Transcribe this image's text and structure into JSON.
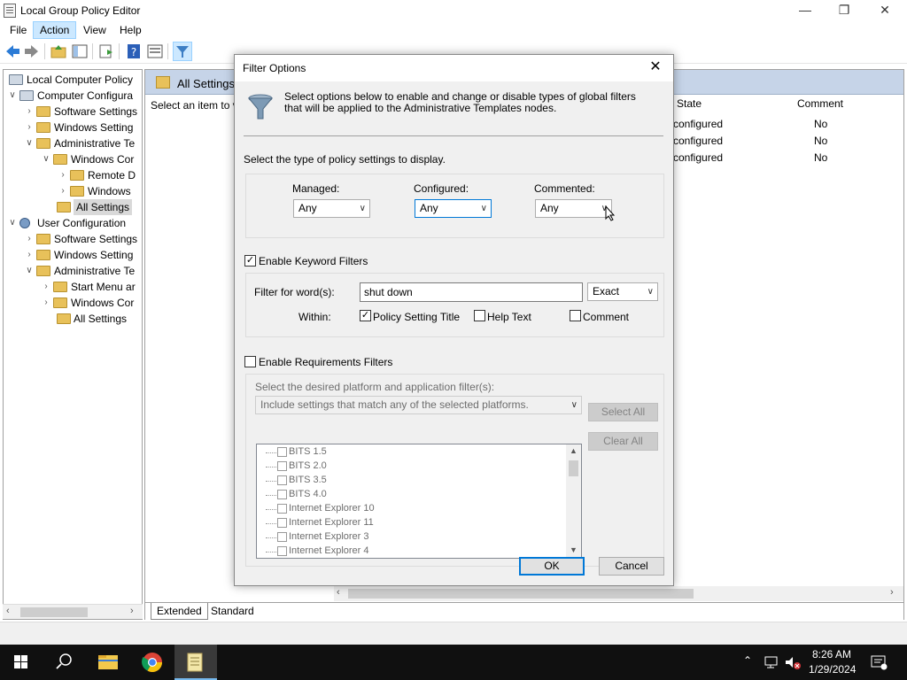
{
  "window": {
    "title": "Local Group Policy Editor"
  },
  "menu": {
    "items": [
      "File",
      "Action",
      "View",
      "Help"
    ],
    "active": "Action"
  },
  "tree": {
    "items": [
      {
        "label": "Local Computer Policy"
      },
      {
        "label": "Computer Configura"
      },
      {
        "label": "Software Settings"
      },
      {
        "label": "Windows Setting"
      },
      {
        "label": "Administrative Te"
      },
      {
        "label": "Windows Cor"
      },
      {
        "label": "Remote D"
      },
      {
        "label": "Windows"
      },
      {
        "label": "All Settings"
      },
      {
        "label": "User Configuration"
      },
      {
        "label": "Software Settings"
      },
      {
        "label": "Windows Setting"
      },
      {
        "label": "Administrative Te"
      },
      {
        "label": "Start Menu ar"
      },
      {
        "label": "Windows Cor"
      },
      {
        "label": "All Settings"
      }
    ]
  },
  "right_pane": {
    "header": "All Settings",
    "description": "Select an item to v",
    "columns": {
      "state": "State",
      "comment": "Comment"
    },
    "rows": [
      {
        "state": "configured",
        "comment": "No"
      },
      {
        "state": "configured",
        "comment": "No"
      },
      {
        "state": "configured",
        "comment": "No"
      }
    ],
    "tabs": [
      "Extended",
      "Standard"
    ]
  },
  "dialog": {
    "title": "Filter Options",
    "intro": "Select options below to enable and change or disable types of global filters that will be applied to the Administrative Templates nodes.",
    "type_label": "Select the type of policy settings to display.",
    "managed": {
      "label": "Managed:",
      "value": "Any"
    },
    "configured": {
      "label": "Configured:",
      "value": "Any"
    },
    "commented": {
      "label": "Commented:",
      "value": "Any"
    },
    "keyword": {
      "enable_label": "Enable Keyword Filters",
      "enabled": true,
      "filter_label": "Filter for word(s):",
      "filter_value": "shut down",
      "match_value": "Exact",
      "within_label": "Within:",
      "policy_title": {
        "label": "Policy Setting Title",
        "checked": true
      },
      "help_text": {
        "label": "Help Text",
        "checked": false
      },
      "comment": {
        "label": "Comment",
        "checked": false
      }
    },
    "requirements": {
      "enable_label": "Enable Requirements Filters",
      "enabled": false,
      "platform_label": "Select the desired platform and application filter(s):",
      "platform_combo": "Include settings that match any of the selected platforms.",
      "select_all": "Select All",
      "clear_all": "Clear All",
      "platforms": [
        "BITS 1.5",
        "BITS 2.0",
        "BITS 3.5",
        "BITS 4.0",
        "Internet Explorer 10",
        "Internet Explorer 11",
        "Internet Explorer 3",
        "Internet Explorer 4"
      ]
    },
    "ok": "OK",
    "cancel": "Cancel"
  },
  "taskbar": {
    "time": "8:26 AM",
    "date": "1/29/2024"
  },
  "colors": {
    "accent": "#0078d7",
    "header_bg": "#c6d4e8",
    "taskbar": "#101010"
  }
}
